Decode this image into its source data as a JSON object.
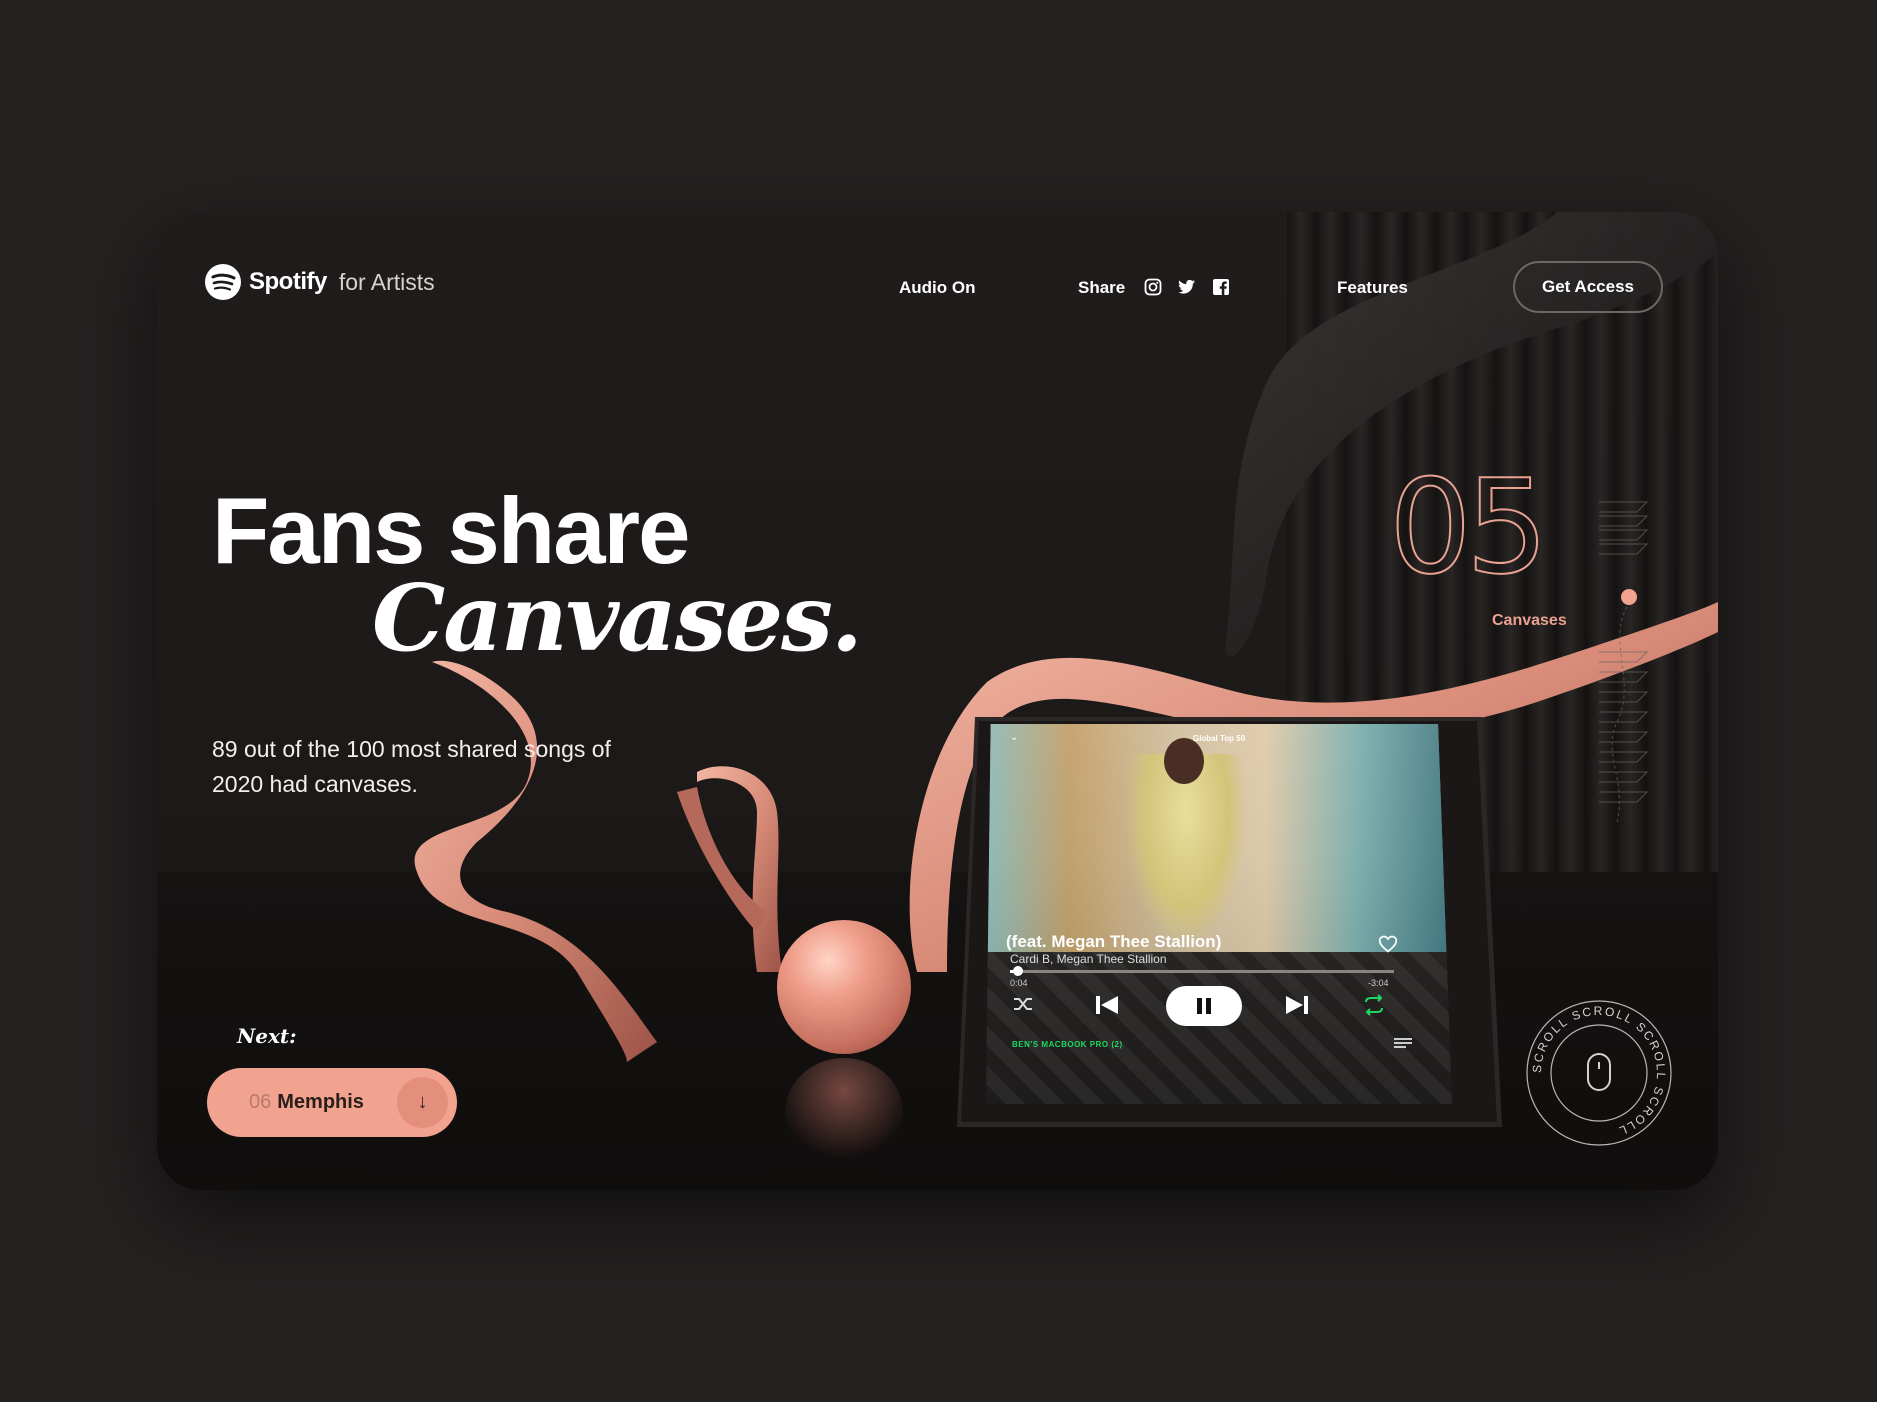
{
  "header": {
    "brand": "Spotify",
    "brand_suffix": "for Artists",
    "audio_label": "Audio On",
    "share_label": "Share",
    "features_label": "Features",
    "cta_label": "Get Access"
  },
  "hero": {
    "title_line1": "Fans share",
    "title_line2": "Canvases.",
    "description": "89 out of the 100 most shared songs of 2020 had canvases."
  },
  "next": {
    "label": "Next:",
    "number": "06",
    "title": "Memphis",
    "arrow": "↓"
  },
  "counter": {
    "number": "05",
    "label": "Canvases"
  },
  "player": {
    "playlist": "Global Top 50",
    "song": "(feat. Megan Thee Stallion)",
    "artists": "Cardi B, Megan Thee Stallion",
    "elapsed": "0:04",
    "remaining": "-3:04",
    "progress": 0.02,
    "device": "BEN'S MACBOOK PRO (2)"
  },
  "scroll_badge": {
    "text": "SCROLL SCROLL SCROLL SCROLL"
  },
  "colors": {
    "accent": "#f2a38f",
    "spotify_green": "#1ed760",
    "background": "#242221"
  }
}
